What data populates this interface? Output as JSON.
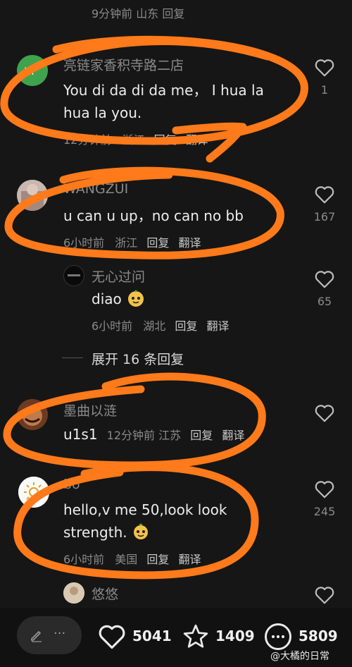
{
  "top_partial_meta": "9分钟前  山东  回复",
  "comments": [
    {
      "name": "亮链家香积寺路二店",
      "text": "You di da di da me， I hua la hua la you.",
      "time": "12分钟前",
      "region": "浙江",
      "reply": "回复",
      "translate": "翻译",
      "likes": "1"
    },
    {
      "name": "WANGZUI",
      "text": "u can u up，no can no bb",
      "time": "6小时前",
      "region": "浙江",
      "reply": "回复",
      "translate": "翻译",
      "likes": "167"
    },
    {
      "name": "无心过问",
      "text": "diao",
      "time": "6小时前",
      "region": "湖北",
      "reply": "回复",
      "translate": "翻译",
      "likes": "65"
    },
    {
      "name": "墨曲以涟",
      "text": "u1s1",
      "time": "12分钟前",
      "region": "江苏",
      "reply": "回复",
      "translate": "翻译",
      "likes": ""
    },
    {
      "name": "bo",
      "text": "hello,v me 50,look look strength.",
      "time": "6小时前",
      "region": "美国",
      "reply": "回复",
      "translate": "翻译",
      "likes": "245"
    },
    {
      "name": "悠悠",
      "likes": ""
    }
  ],
  "expand_replies": "展开 16 条回复",
  "bottom_bar": {
    "likes": "5041",
    "favorites": "1409",
    "comments": "5809",
    "more": "···"
  },
  "watermark": "@大橘的日常",
  "colors": {
    "background": "#161616",
    "annotation": "#ff7a1a"
  }
}
